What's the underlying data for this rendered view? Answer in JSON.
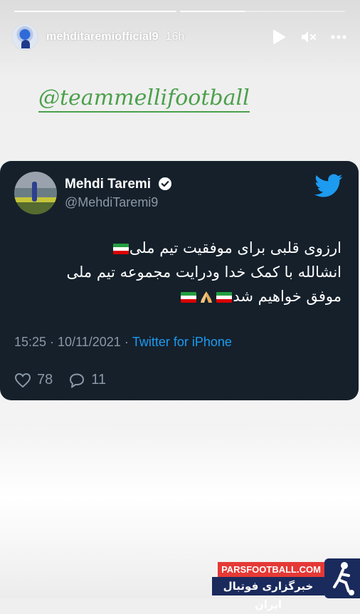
{
  "story": {
    "username": "mehditaremiofficial9",
    "time_ago": "16h",
    "mention": "@teammellifootball",
    "icons": {
      "play": "play-icon",
      "mute": "mute-icon",
      "more": "more-icon"
    }
  },
  "tweet": {
    "name": "Mehdi Taremi",
    "handle": "@MehdiTaremi9",
    "lines": [
      "ارزوی قلبی برای موفقیت تیم ملی",
      "انشالله با کمک خدا ودرایت مجموعه تیم ملی",
      "موفق خواهیم شد"
    ],
    "time": "15:25",
    "date": "10/11/2021",
    "separator": "·",
    "source": "Twitter for iPhone",
    "likes": "78",
    "replies": "11",
    "colors": {
      "background": "#15202b",
      "accent": "#1d9bf0",
      "muted": "#8b98a5"
    }
  },
  "watermark": {
    "site": "PARSFOOTBALL.COM",
    "tagline": "خبرگزاری فوتبال ایران"
  }
}
